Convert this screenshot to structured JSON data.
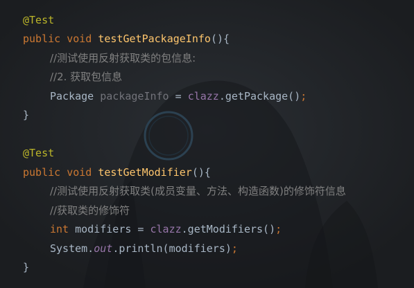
{
  "theme": {
    "background": "#1e2023",
    "annotation_color": "#bbb529",
    "keyword_color": "#cc7832",
    "method_color": "#ffc66d",
    "comment_color": "#808080",
    "field_color": "#9876aa",
    "text_color": "#a9b7c6"
  },
  "method1": {
    "annotation": "@Test",
    "kw_public": "public",
    "kw_void": "void",
    "name": "testGetPackageInfo",
    "open": "(){",
    "comment1": "//测试使用反射获取类的包信息:",
    "comment2": "//2. 获取包信息",
    "stmt_type": "Package",
    "stmt_var": "packageInfo",
    "stmt_eq": " = ",
    "stmt_field": "clazz",
    "stmt_call": ".getPackage()",
    "stmt_semi": ";",
    "close": "}"
  },
  "method2": {
    "annotation": "@Test",
    "kw_public": "public",
    "kw_void": "void",
    "name": "testGetModifier",
    "open": "(){",
    "comment1": "//测试使用反射获取类(成员变量、方法、构造函数)的修饰符信息",
    "comment2": "//获取类的修饰符",
    "stmt1_type": "int",
    "stmt1_var": " modifiers = ",
    "stmt1_field": "clazz",
    "stmt1_call": ".getModifiers()",
    "stmt1_semi": ";",
    "stmt2_obj": "System.",
    "stmt2_field": "out",
    "stmt2_call": ".println(modifiers)",
    "stmt2_semi": ";",
    "close": "}"
  }
}
